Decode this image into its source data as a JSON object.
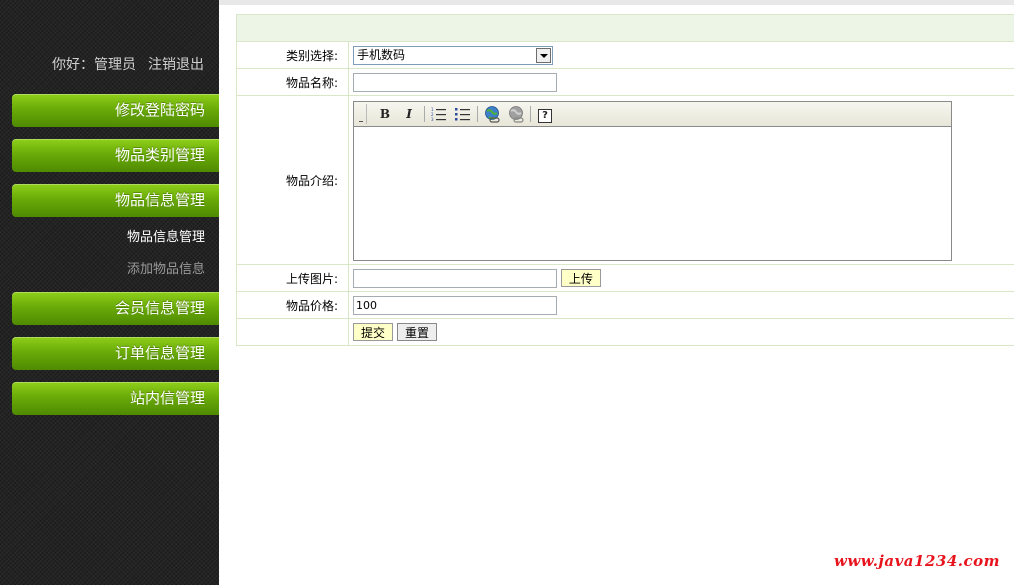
{
  "sidebar": {
    "greeting": "你好：管理员",
    "logout": "注销退出",
    "menu": [
      {
        "label": "修改登陆密码"
      },
      {
        "label": "物品类别管理"
      },
      {
        "label": "物品信息管理"
      },
      {
        "label": "会员信息管理"
      },
      {
        "label": "订单信息管理"
      },
      {
        "label": "站内信管理"
      }
    ],
    "submenu": [
      {
        "label": "物品信息管理"
      },
      {
        "label": "添加物品信息"
      }
    ]
  },
  "form": {
    "category_label": "类别选择:",
    "category_value": "手机数码",
    "name_label": "物品名称:",
    "name_value": "",
    "intro_label": "物品介绍:",
    "upload_label": "上传图片:",
    "upload_value": "",
    "upload_button": "上传",
    "price_label": "物品价格:",
    "price_value": "100",
    "submit_button": "提交",
    "reset_button": "重置"
  },
  "editor": {
    "bold": "B",
    "italic": "I",
    "help": "?"
  },
  "watermark": "www.java1234.com"
}
